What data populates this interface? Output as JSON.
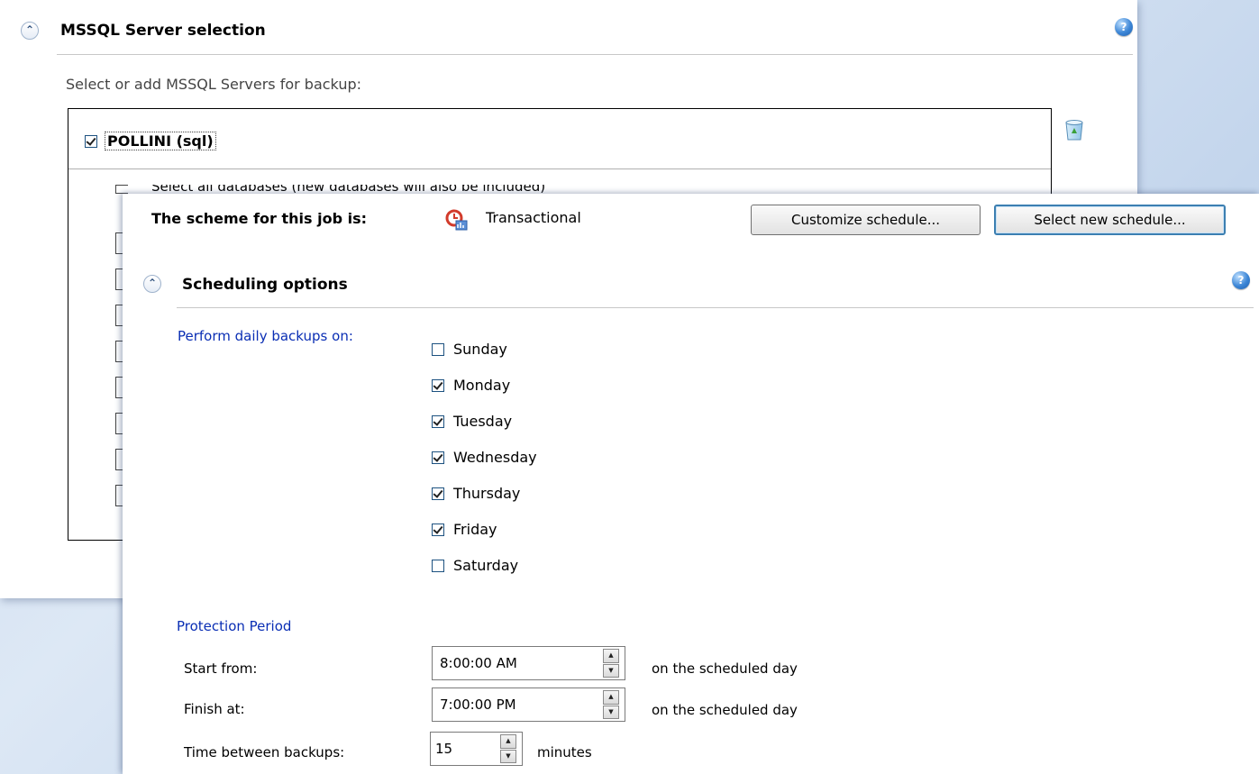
{
  "server_selection": {
    "title": "MSSQL Server selection",
    "subtitle": "Select or add MSSQL Servers for backup:",
    "server": {
      "name": "POLLINI (sql)",
      "checked": true
    },
    "partial_row_text": "Select all databases (new databases will also be included)",
    "recycle_icon": "recycle-bin-icon"
  },
  "scheme": {
    "label": "The scheme for this job is:",
    "value": "Transactional",
    "icon": "schedule-clock-icon",
    "customize_button": "Customize schedule...",
    "select_button": "Select new schedule..."
  },
  "scheduling": {
    "title": "Scheduling options",
    "daily_label": "Perform daily backups on:",
    "days": [
      {
        "label": "Sunday",
        "checked": false
      },
      {
        "label": "Monday",
        "checked": true
      },
      {
        "label": "Tuesday",
        "checked": true
      },
      {
        "label": "Wednesday",
        "checked": true
      },
      {
        "label": "Thursday",
        "checked": true
      },
      {
        "label": "Friday",
        "checked": true
      },
      {
        "label": "Saturday",
        "checked": false
      }
    ],
    "protection": {
      "title": "Protection Period",
      "start_label": "Start from:",
      "start_value": "8:00:00 AM",
      "start_suffix": "on the scheduled day",
      "finish_label": "Finish at:",
      "finish_value": "7:00:00 PM",
      "finish_suffix": "on the scheduled day",
      "interval_label": "Time between backups:",
      "interval_value": "15",
      "interval_suffix": "minutes"
    }
  },
  "colors": {
    "link_blue": "#0a2eb4",
    "accent": "#3c7fb1"
  }
}
